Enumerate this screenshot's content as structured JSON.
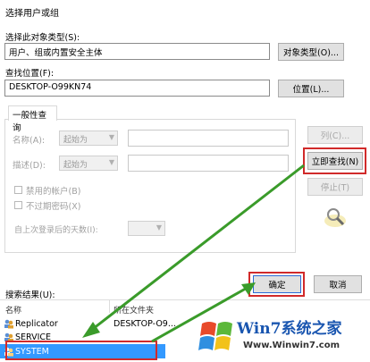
{
  "window": {
    "title": "选择用户或组"
  },
  "object_type": {
    "label": "选择此对象类型(S):",
    "value": "用户、组或内置安全主体",
    "button": "对象类型(O)..."
  },
  "location": {
    "label": "查找位置(F):",
    "value": "DESKTOP-O99KN74",
    "button": "位置(L)..."
  },
  "tab": {
    "label": "一般性查询"
  },
  "query": {
    "name_label": "名称(A):",
    "name_mode": "起始为",
    "desc_label": "描述(D):",
    "desc_mode": "起始为",
    "disabled_accounts": "禁用的帐户(B)",
    "no_expire": "不过期密码(X)",
    "days_label": "自上次登录后的天数(I):"
  },
  "buttons": {
    "columns": "列(C)...",
    "find_now": "立即查找(N)",
    "stop": "停止(T)",
    "ok": "确定",
    "cancel": "取消"
  },
  "results": {
    "label": "搜索结果(U):",
    "columns": [
      "名称",
      "所在文件夹"
    ],
    "rows": [
      {
        "name": "Replicator",
        "folder": "DESKTOP-O9..."
      },
      {
        "name": "SERVICE",
        "folder": ""
      },
      {
        "name": "SYSTEM",
        "folder": ""
      }
    ]
  },
  "watermark": {
    "brand": "Win7系统之家",
    "url": "Www.Winwin7.com"
  },
  "colors": {
    "highlight_red": "#d12a2a",
    "arrow_green": "#3a9b2a",
    "selection_blue": "#3399ff"
  }
}
